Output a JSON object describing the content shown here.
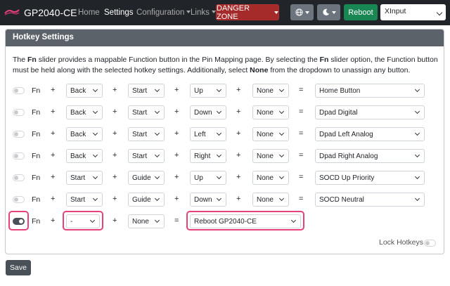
{
  "navbar": {
    "brand": "GP2040-CE",
    "links": [
      {
        "label": "Home"
      },
      {
        "label": "Settings"
      },
      {
        "label": "Configuration"
      },
      {
        "label": "Links"
      }
    ],
    "danger_label": "DANGER ZONE",
    "reboot_label": "Reboot",
    "input_mode": "XInput"
  },
  "card": {
    "title": "Hotkey Settings",
    "desc": {
      "p1": "The ",
      "b1": "Fn",
      "p2": " slider provides a mappable Function button in the Pin Mapping page. By selecting the ",
      "b2": "Fn",
      "p3": " slider option, the Function button must be held along with the selected hotkey settings. Additionally, select ",
      "b3": "None",
      "p4": " from the dropdown to unassign any button."
    },
    "fn_label": "Fn",
    "plus": "+",
    "equals": "=",
    "rows": [
      {
        "b1": "Back",
        "b2": "Start",
        "b3": "Up",
        "b4": "None",
        "action": "Home Button"
      },
      {
        "b1": "Back",
        "b2": "Start",
        "b3": "Down",
        "b4": "None",
        "action": "Dpad Digital"
      },
      {
        "b1": "Back",
        "b2": "Start",
        "b3": "Left",
        "b4": "None",
        "action": "Dpad Left Analog"
      },
      {
        "b1": "Back",
        "b2": "Start",
        "b3": "Right",
        "b4": "None",
        "action": "Dpad Right Analog"
      },
      {
        "b1": "Start",
        "b2": "Guide",
        "b3": "Up",
        "b4": "None",
        "action": "SOCD Up Priority"
      },
      {
        "b1": "Start",
        "b2": "Guide",
        "b3": "Down",
        "b4": "None",
        "action": "SOCD Neutral"
      }
    ],
    "last_row": {
      "b1": "-",
      "b2": "None",
      "action": "Reboot GP2040-CE"
    },
    "lock_label": "Lock Hotkeys"
  },
  "save_label": "Save",
  "colors": {
    "navbar": "#212529",
    "danger": "#a52a2a",
    "reboot": "#198754",
    "header": "#5b626a",
    "highlight": "#e6417a"
  }
}
